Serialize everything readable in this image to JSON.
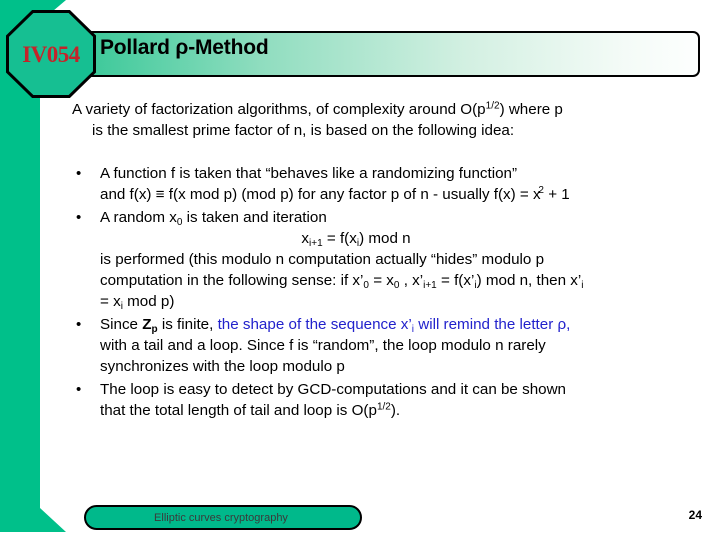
{
  "badge": {
    "label": "IV054",
    "shape": "octagon",
    "fill_color": "#16bf92",
    "text_color": "#c4242a"
  },
  "header": {
    "title": "Pollard ρ-Method",
    "band_gradient_from": "#3dc99a",
    "band_gradient_to": "#fdfffe"
  },
  "accent_bar_color": "#00c08a",
  "intro": {
    "line1": "A variety of factorization algorithms, of complexity around O(p",
    "line1_sup": "1/2",
    "line1_tail": ") where p",
    "line2": "is the smallest prime factor of n, is based on the following idea:"
  },
  "bullets": [
    {
      "marker": "•",
      "lines": [
        "A function f is taken that “behaves like a randomizing function”",
        "and f(x) ≡ f(x mod p) (mod p) for any factor p of n - usually f(x) = x"
      ],
      "line2_sup": "2",
      "line2_tail": " + 1"
    },
    {
      "marker": "•",
      "line1_a": "A random x",
      "line1_sub": "0",
      "line1_b": " is taken and iteration",
      "formula_a": "x",
      "formula_sub1": "i+1",
      "formula_b": " = f(x",
      "formula_sub2": "i",
      "formula_c": ") mod n",
      "line3": "is performed (this modulo n computation actually “hides” modulo p",
      "line4_a": "computation in the following sense: if x’",
      "line4_sub1": "0",
      "line4_b": " = x",
      "line4_sub2": "0",
      "line4_c": " , x’",
      "line4_sub3": "i+1",
      "line4_d": " = f(x’",
      "line4_sub4": "i",
      "line4_e": ") mod n, then x’",
      "line4_sub5": "i",
      "line5_a": "= x",
      "line5_sub": "i",
      "line5_b": " mod p)"
    },
    {
      "marker": "•",
      "seg1": "Since ",
      "seg_bold": "Z",
      "seg_sub": "p",
      "seg2": " is finite, ",
      "seg_blue_a": "the shape of the sequence x’",
      "seg_blue_sub": "i",
      "seg_blue_b": " will remind the letter ρ,",
      "line2": "with a tail and a loop. Since f is “random”, the loop modulo n rarely",
      "line3": "synchronizes with the loop modulo p",
      "highlight_color": "#2222cc"
    },
    {
      "marker": "•",
      "line1": "The loop is easy to detect by GCD-computations and it can be shown",
      "line2_a": "that the total length of tail and loop is O(p",
      "line2_sup": "1/2",
      "line2_b": ")."
    }
  ],
  "footer": {
    "pill_label": "Elliptic curves cryptography",
    "pill_color": "#00b98b",
    "page_number": "24"
  }
}
